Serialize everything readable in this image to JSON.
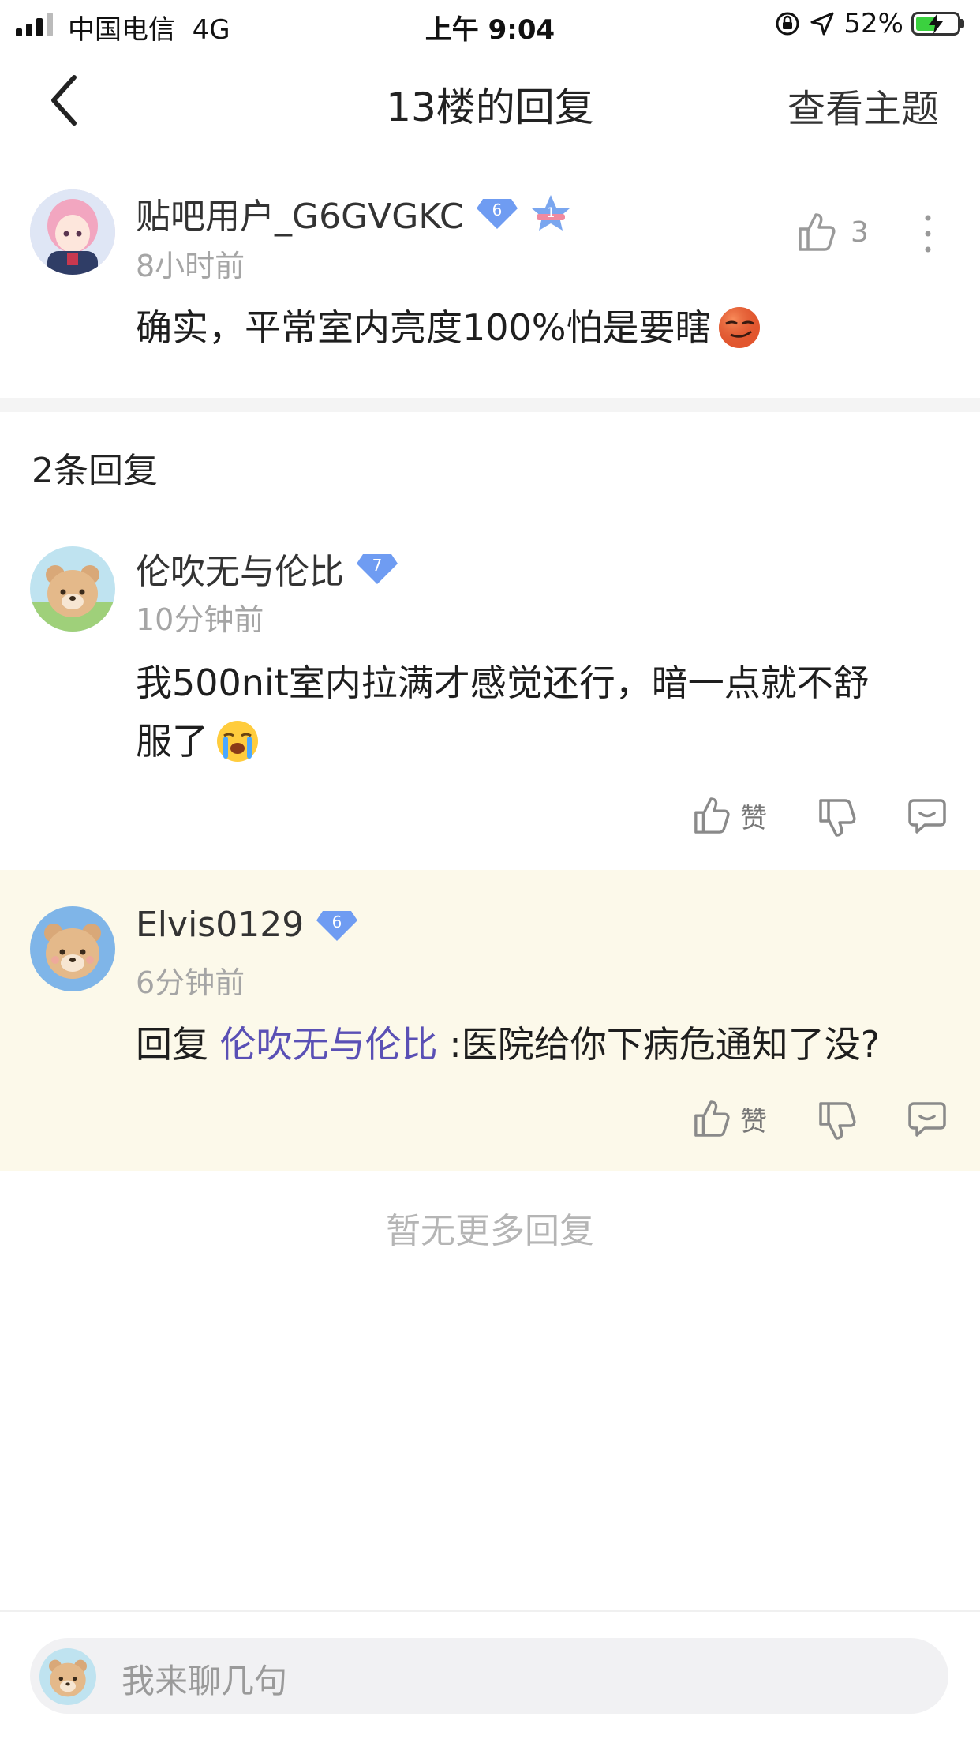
{
  "status_bar": {
    "carrier": "中国电信",
    "network": "4G",
    "time": "上午 9:04",
    "battery": "52%",
    "battery_level": 0.52
  },
  "nav": {
    "title": "13楼的回复",
    "right_label": "查看主题"
  },
  "main_post": {
    "username": "贴吧用户_G6GVGKC",
    "level": "6",
    "rank_badge": "1",
    "time": "8小时前",
    "like_count": "3",
    "content": "确实，平常室内亮度100%怕是要瞎"
  },
  "reply_count_label": "2条回复",
  "replies": [
    {
      "username": "伦吹无与伦比",
      "level": "7",
      "time": "10分钟前",
      "content_line1": "我500nit室内拉满才感觉还行，暗一点就不舒",
      "content_line2": "服了",
      "like_label": "赞"
    },
    {
      "username": "Elvis0129",
      "level": "6",
      "time": "6分钟前",
      "reply_prefix": "回复",
      "reply_target": "伦吹无与伦比",
      "reply_text": ":医院给你下病危通知了没?",
      "like_label": "赞"
    }
  ],
  "no_more_label": "暂无更多回复",
  "input": {
    "placeholder": "我来聊几句"
  },
  "colors": {
    "level_badge": "#6f9cf2",
    "link": "#5a50b5",
    "highlight_bg": "#fcf9ea"
  }
}
